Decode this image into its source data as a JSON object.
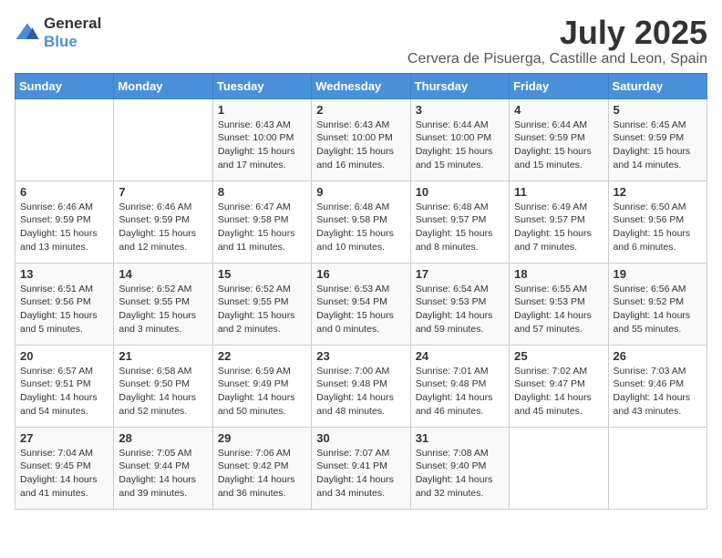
{
  "logo": {
    "text_general": "General",
    "text_blue": "Blue"
  },
  "title": "July 2025",
  "subtitle": "Cervera de Pisuerga, Castille and Leon, Spain",
  "days_of_week": [
    "Sunday",
    "Monday",
    "Tuesday",
    "Wednesday",
    "Thursday",
    "Friday",
    "Saturday"
  ],
  "weeks": [
    [
      {
        "day": "",
        "detail": ""
      },
      {
        "day": "",
        "detail": ""
      },
      {
        "day": "1",
        "detail": "Sunrise: 6:43 AM\nSunset: 10:00 PM\nDaylight: 15 hours\nand 17 minutes."
      },
      {
        "day": "2",
        "detail": "Sunrise: 6:43 AM\nSunset: 10:00 PM\nDaylight: 15 hours\nand 16 minutes."
      },
      {
        "day": "3",
        "detail": "Sunrise: 6:44 AM\nSunset: 10:00 PM\nDaylight: 15 hours\nand 15 minutes."
      },
      {
        "day": "4",
        "detail": "Sunrise: 6:44 AM\nSunset: 9:59 PM\nDaylight: 15 hours\nand 15 minutes."
      },
      {
        "day": "5",
        "detail": "Sunrise: 6:45 AM\nSunset: 9:59 PM\nDaylight: 15 hours\nand 14 minutes."
      }
    ],
    [
      {
        "day": "6",
        "detail": "Sunrise: 6:46 AM\nSunset: 9:59 PM\nDaylight: 15 hours\nand 13 minutes."
      },
      {
        "day": "7",
        "detail": "Sunrise: 6:46 AM\nSunset: 9:59 PM\nDaylight: 15 hours\nand 12 minutes."
      },
      {
        "day": "8",
        "detail": "Sunrise: 6:47 AM\nSunset: 9:58 PM\nDaylight: 15 hours\nand 11 minutes."
      },
      {
        "day": "9",
        "detail": "Sunrise: 6:48 AM\nSunset: 9:58 PM\nDaylight: 15 hours\nand 10 minutes."
      },
      {
        "day": "10",
        "detail": "Sunrise: 6:48 AM\nSunset: 9:57 PM\nDaylight: 15 hours\nand 8 minutes."
      },
      {
        "day": "11",
        "detail": "Sunrise: 6:49 AM\nSunset: 9:57 PM\nDaylight: 15 hours\nand 7 minutes."
      },
      {
        "day": "12",
        "detail": "Sunrise: 6:50 AM\nSunset: 9:56 PM\nDaylight: 15 hours\nand 6 minutes."
      }
    ],
    [
      {
        "day": "13",
        "detail": "Sunrise: 6:51 AM\nSunset: 9:56 PM\nDaylight: 15 hours\nand 5 minutes."
      },
      {
        "day": "14",
        "detail": "Sunrise: 6:52 AM\nSunset: 9:55 PM\nDaylight: 15 hours\nand 3 minutes."
      },
      {
        "day": "15",
        "detail": "Sunrise: 6:52 AM\nSunset: 9:55 PM\nDaylight: 15 hours\nand 2 minutes."
      },
      {
        "day": "16",
        "detail": "Sunrise: 6:53 AM\nSunset: 9:54 PM\nDaylight: 15 hours\nand 0 minutes."
      },
      {
        "day": "17",
        "detail": "Sunrise: 6:54 AM\nSunset: 9:53 PM\nDaylight: 14 hours\nand 59 minutes."
      },
      {
        "day": "18",
        "detail": "Sunrise: 6:55 AM\nSunset: 9:53 PM\nDaylight: 14 hours\nand 57 minutes."
      },
      {
        "day": "19",
        "detail": "Sunrise: 6:56 AM\nSunset: 9:52 PM\nDaylight: 14 hours\nand 55 minutes."
      }
    ],
    [
      {
        "day": "20",
        "detail": "Sunrise: 6:57 AM\nSunset: 9:51 PM\nDaylight: 14 hours\nand 54 minutes."
      },
      {
        "day": "21",
        "detail": "Sunrise: 6:58 AM\nSunset: 9:50 PM\nDaylight: 14 hours\nand 52 minutes."
      },
      {
        "day": "22",
        "detail": "Sunrise: 6:59 AM\nSunset: 9:49 PM\nDaylight: 14 hours\nand 50 minutes."
      },
      {
        "day": "23",
        "detail": "Sunrise: 7:00 AM\nSunset: 9:48 PM\nDaylight: 14 hours\nand 48 minutes."
      },
      {
        "day": "24",
        "detail": "Sunrise: 7:01 AM\nSunset: 9:48 PM\nDaylight: 14 hours\nand 46 minutes."
      },
      {
        "day": "25",
        "detail": "Sunrise: 7:02 AM\nSunset: 9:47 PM\nDaylight: 14 hours\nand 45 minutes."
      },
      {
        "day": "26",
        "detail": "Sunrise: 7:03 AM\nSunset: 9:46 PM\nDaylight: 14 hours\nand 43 minutes."
      }
    ],
    [
      {
        "day": "27",
        "detail": "Sunrise: 7:04 AM\nSunset: 9:45 PM\nDaylight: 14 hours\nand 41 minutes."
      },
      {
        "day": "28",
        "detail": "Sunrise: 7:05 AM\nSunset: 9:44 PM\nDaylight: 14 hours\nand 39 minutes."
      },
      {
        "day": "29",
        "detail": "Sunrise: 7:06 AM\nSunset: 9:42 PM\nDaylight: 14 hours\nand 36 minutes."
      },
      {
        "day": "30",
        "detail": "Sunrise: 7:07 AM\nSunset: 9:41 PM\nDaylight: 14 hours\nand 34 minutes."
      },
      {
        "day": "31",
        "detail": "Sunrise: 7:08 AM\nSunset: 9:40 PM\nDaylight: 14 hours\nand 32 minutes."
      },
      {
        "day": "",
        "detail": ""
      },
      {
        "day": "",
        "detail": ""
      }
    ]
  ]
}
